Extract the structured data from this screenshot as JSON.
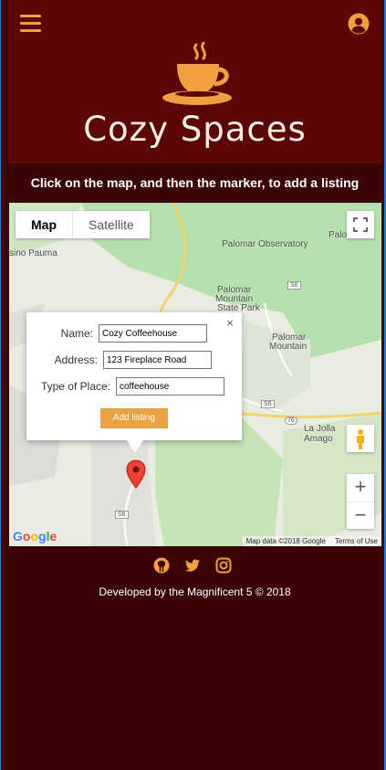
{
  "header": {
    "brand": "Cozy Spaces"
  },
  "instruction": "Click on the map, and then the marker, to add a listing",
  "map": {
    "type_tabs": {
      "map": "Map",
      "satellite": "Satellite"
    },
    "labels": {
      "observatory": "Palomar Observatory",
      "palomar_mountain_park_1": "Palomar",
      "palomar_mountain_park_2": "Mountain",
      "palomar_mountain_park_3": "State Park",
      "palomar_mountain_1": "Palomar",
      "palomar_mountain_2": "Mountain",
      "la_jolla_1": "La Jolla",
      "la_jolla_2": "Amago",
      "pauma": "sino Pauma",
      "s6_a": "S6",
      "s6_b": "S6",
      "s6_c": "S6",
      "r76": "76",
      "topright": "Palo"
    },
    "zoom_in": "+",
    "zoom_out": "−",
    "attribution": {
      "data": "Map data ©2018 Google",
      "terms": "Terms of Use"
    },
    "google_logo": {
      "G": "G",
      "o1": "o",
      "o2": "o",
      "g": "g",
      "l": "l",
      "e": "e"
    }
  },
  "infowindow": {
    "close": "×",
    "name_label": "Name:",
    "name_value": "Cozy Coffeehouse",
    "address_label": "Address:",
    "address_value": "123 Fireplace Road",
    "type_label": "Type of Place:",
    "type_value": "coffeehouse",
    "add_button": "Add listing"
  },
  "footer": {
    "text": "Developed by the Magnificent 5 © 2018"
  },
  "colors": {
    "header_bg": "#5c0707",
    "page_bg": "#3b0505",
    "accent": "#f0a040",
    "button": "#eaa144"
  },
  "icons": [
    "menu-icon",
    "user-icon",
    "coffee-cup-logo",
    "fullscreen-icon",
    "pegman-icon",
    "map-marker-icon",
    "github-icon",
    "twitter-icon",
    "instagram-icon"
  ]
}
